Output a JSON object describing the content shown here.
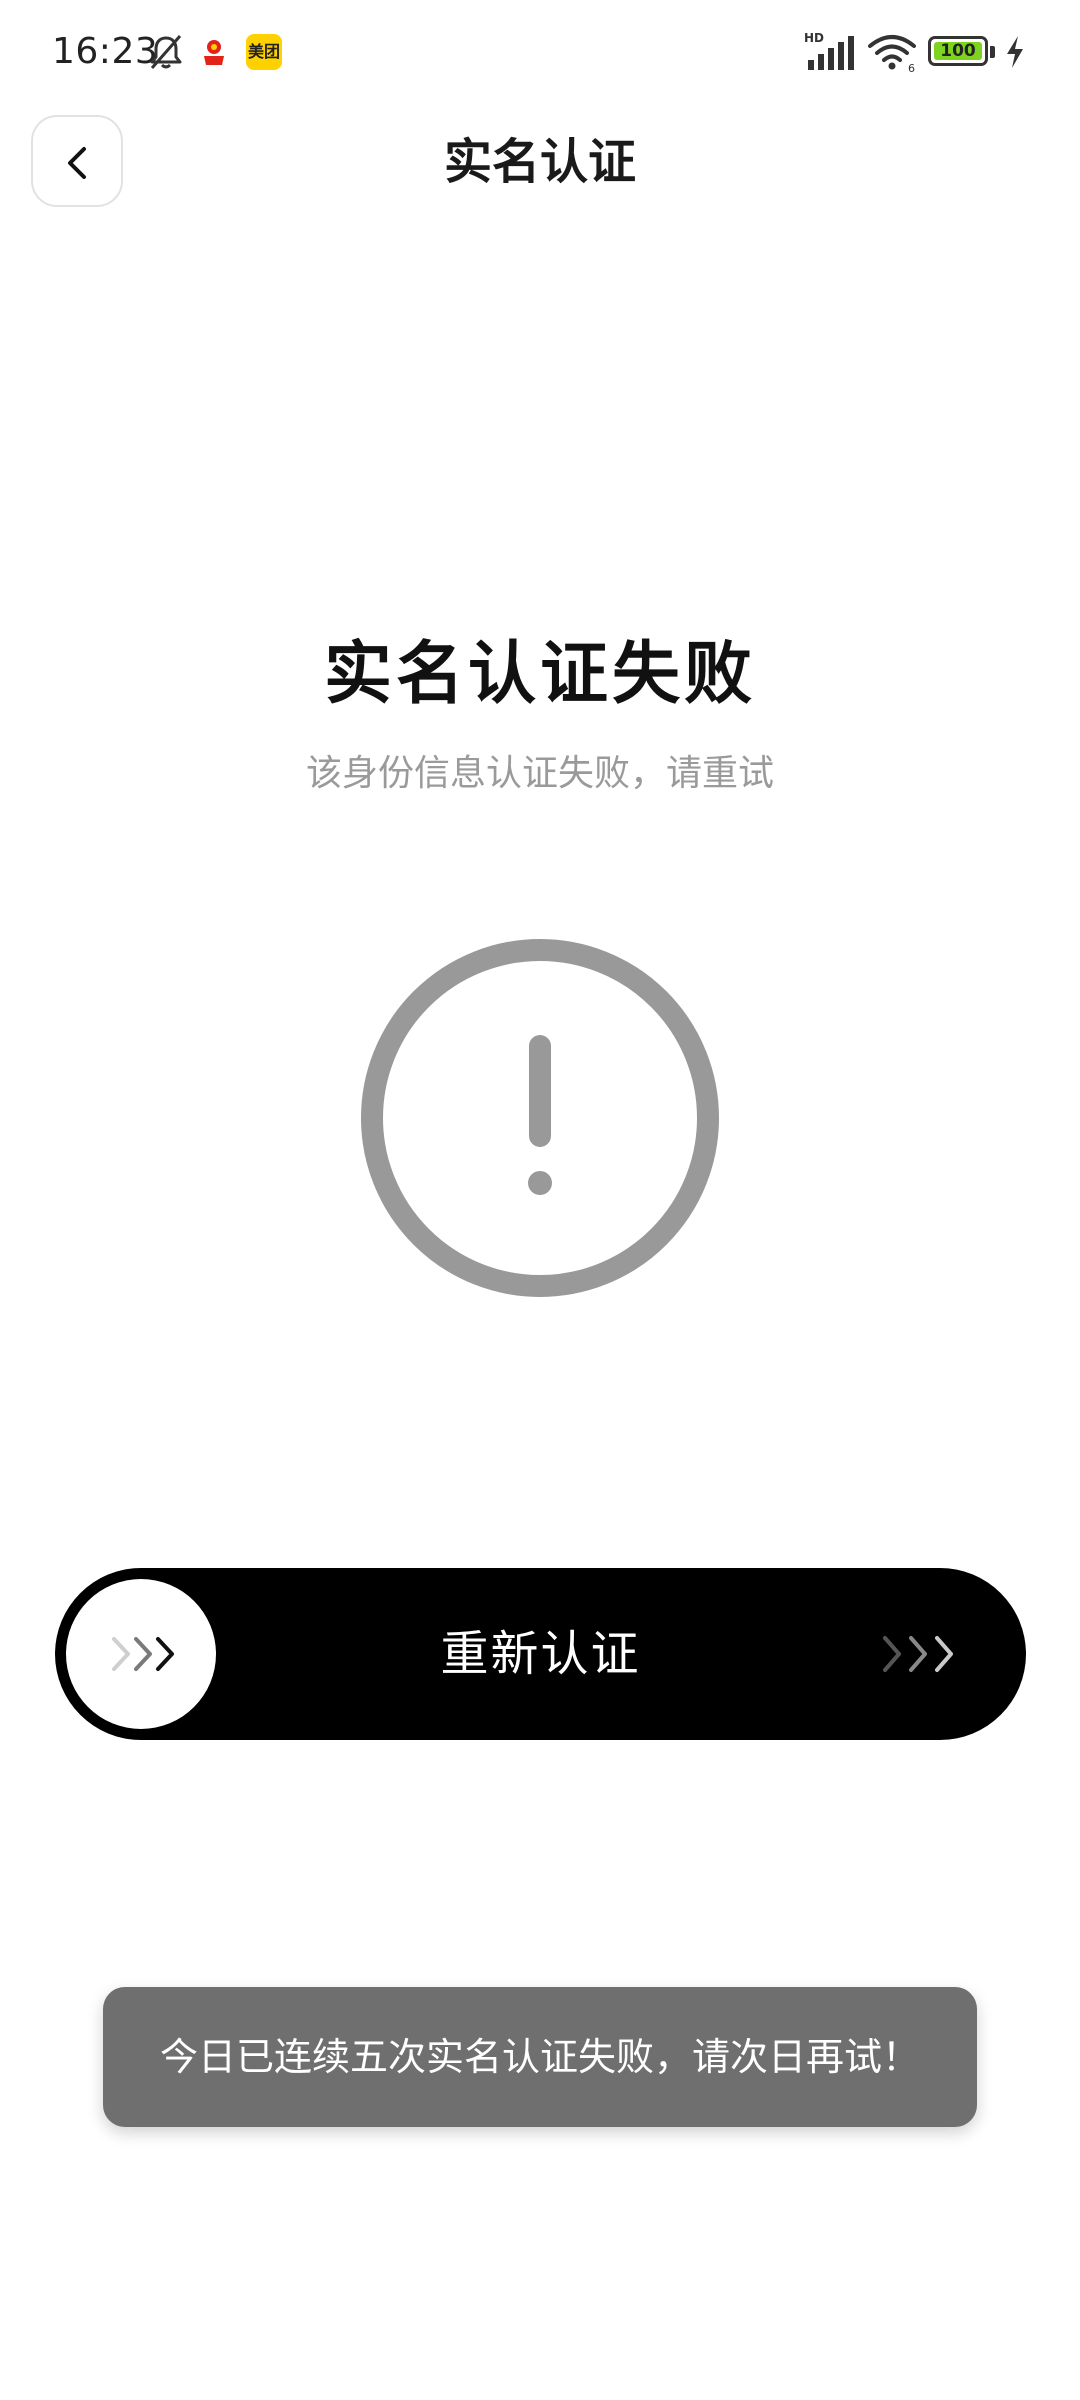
{
  "status_bar": {
    "time": "16:23",
    "battery_level": "100",
    "network": "HD",
    "wifi_level": "6",
    "icons": [
      "bell-muted-icon",
      "kuaishou-app-icon",
      "meituan-app-icon",
      "signal-icon",
      "wifi-icon",
      "battery-icon",
      "charging-icon"
    ],
    "meituan_label": "美团"
  },
  "header": {
    "title": "实名认证",
    "back_icon": "chevron-left-icon"
  },
  "result": {
    "title": "实名认证失败",
    "subtitle": "该身份信息认证失败，请重试",
    "icon": "exclamation-circle-icon",
    "icon_color": "#999999"
  },
  "retry": {
    "label": "重新认证",
    "knob_icon": "triple-chevron-right-icon"
  },
  "toast": {
    "message": "今日已连续五次实名认证失败，请次日再试！"
  },
  "colors": {
    "slider_bg": "#000000",
    "toast_bg": "#6f6f6f",
    "subtitle": "#9a9a9a"
  }
}
